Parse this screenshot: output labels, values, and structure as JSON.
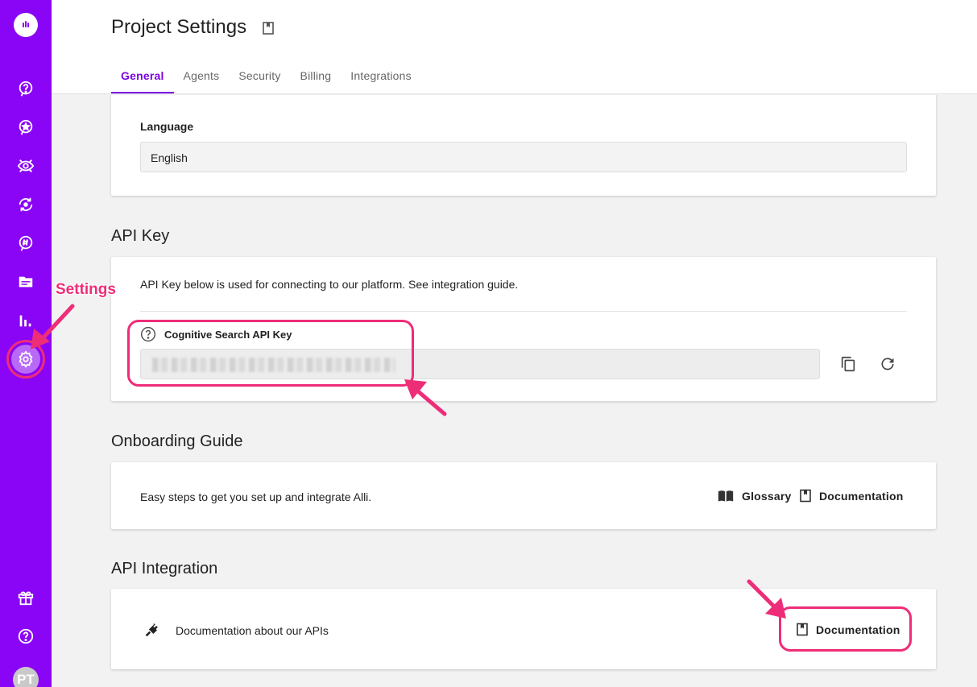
{
  "sidebar": {
    "items": [
      {
        "name": "help-bubble-icon"
      },
      {
        "name": "star-badge-icon"
      },
      {
        "name": "eye-icon"
      },
      {
        "name": "sync-icon"
      },
      {
        "name": "hashtag-icon"
      },
      {
        "name": "folder-icon"
      },
      {
        "name": "bar-chart-icon"
      },
      {
        "name": "gear-icon",
        "active": true
      }
    ],
    "bottom_items": [
      {
        "name": "gift-icon"
      },
      {
        "name": "help-icon"
      }
    ],
    "avatar_initials": "PT",
    "accent": "#8a05f5"
  },
  "header": {
    "title": "Project Settings",
    "tabs": [
      {
        "label": "General",
        "active": true
      },
      {
        "label": "Agents"
      },
      {
        "label": "Security"
      },
      {
        "label": "Billing"
      },
      {
        "label": "Integrations"
      }
    ]
  },
  "general": {
    "language_label": "Language",
    "language_value": "English"
  },
  "api_key": {
    "section_title": "API Key",
    "description": "API Key below is used for connecting to our platform. See integration guide.",
    "key_label": "Cognitive Search API Key"
  },
  "onboarding": {
    "section_title": "Onboarding Guide",
    "description": "Easy steps to get you set up and integrate Alli.",
    "glossary_label": "Glossary",
    "documentation_label": "Documentation"
  },
  "api_integration": {
    "section_title": "API Integration",
    "description": "Documentation about our APIs",
    "documentation_label": "Documentation"
  },
  "annotations": {
    "settings_label": "Settings",
    "color": "#ee2d78"
  }
}
